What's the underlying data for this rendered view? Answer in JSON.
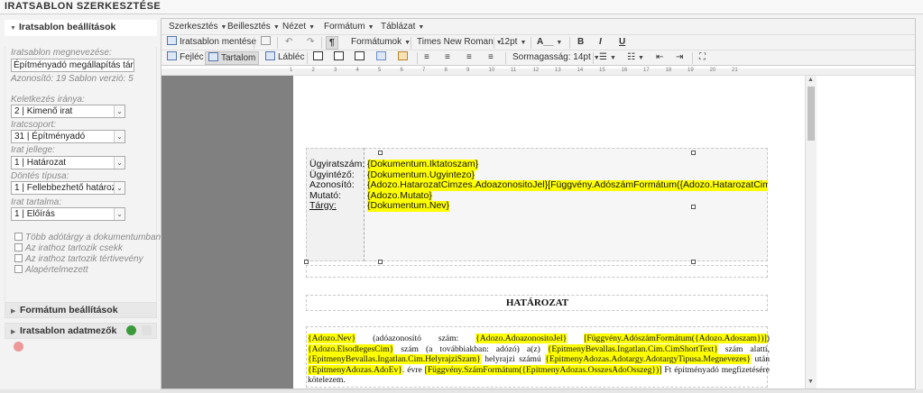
{
  "window": {
    "title": "IRATSABLON SZERKESZTÉSE"
  },
  "sidebar": {
    "settings_panel": {
      "title": "Iratsablon beállítások",
      "name_label": "Iratsablon megnevezése:",
      "name_value": "Építményadó megállapítás tárgy é",
      "meta_text": "Azonosító: 19  Sablon verzió: 5",
      "direction_label": "Keletkezés iránya:",
      "direction_value": "2 | Kimenő irat",
      "group_label": "Iratcsoport:",
      "group_value": "31 | Építményadó",
      "nature_label": "Irat jellege:",
      "nature_value": "1 | Határozat",
      "decision_label": "Döntés típusa:",
      "decision_value": "1 | Fellebbezhető határozat/v",
      "content_label": "Irat tartalma:",
      "content_value": "1 | Előírás",
      "checkboxes": [
        "Több adótárgy a dokumentumban",
        "Az irathoz tartozik csekk",
        "Az irathoz tartozik tértivevény",
        "Alapértelmezett"
      ]
    },
    "format_panel": {
      "title": "Formátum beállítások"
    },
    "fields_panel": {
      "title": "Iratsablon adatmezők"
    }
  },
  "editor": {
    "menus": [
      "Szerkesztés",
      "Beillesztés",
      "Nézet",
      "Formátum",
      "Táblázat"
    ],
    "toolbar1": {
      "save_label": "Iratsablon mentése",
      "formats_label": "Formátumok",
      "font_family": "Times New Roman",
      "font_size": "12pt",
      "font_color": "A__",
      "bold": "B",
      "italic": "I",
      "underline": "U",
      "pilcrow": "¶"
    },
    "toolbar2": {
      "header_label": "Fejléc",
      "content_label": "Tartalom",
      "footer_label": "Lábléc",
      "line_height_label": "Sormagasság: 14pt"
    },
    "ruler_ticks": [
      "1",
      "2",
      "3",
      "4",
      "5",
      "6",
      "7",
      "8",
      "9",
      "10",
      "11",
      "12",
      "13",
      "14",
      "15",
      "16",
      "17",
      "18",
      "19",
      "20",
      "21"
    ],
    "document": {
      "header_rows": [
        {
          "label": "Ügyiratszám:",
          "value": "{Dokumentum.Iktatoszam}"
        },
        {
          "label": "Ügyintéző:",
          "value": "{Dokumentum.Ugyintezo}"
        },
        {
          "label": "Azonosító:",
          "value": "{Adozo.HatarozatCimzes.AdoazonositoJel}[Függvény.AdószámFormátum({Adozo.HatarozatCimzes"
        },
        {
          "label": "Mutató:",
          "value": "{Adozo.Mutato}"
        },
        {
          "label": "Tárgy:",
          "value": "{Dokumentum.Nev}"
        }
      ],
      "title": "HATÁROZAT",
      "body": [
        {
          "t": "{Adozo.Nev}",
          "h": true
        },
        {
          "t": " (adóazonosító szám: ",
          "h": false
        },
        {
          "t": "{Adozo.AdoazonositoJel}",
          "h": true
        },
        {
          "t": " ",
          "h": false
        },
        {
          "t": "[Függvény.AdószámFormátum({Adozo.Adoszam})]",
          "h": true
        },
        {
          "t": ") ",
          "h": false
        },
        {
          "t": "{Adozo.ElsodlegesCim}",
          "h": true
        },
        {
          "t": " szám (a továbbiakban: adózó) a(z) ",
          "h": false
        },
        {
          "t": "{EpitmenyBevallas.Ingatlan.Cim.CimShortText}",
          "h": true
        },
        {
          "t": " szám alatti, ",
          "h": false
        },
        {
          "t": "{EpitmenyBevallas.Ingatlan.Cim.HelyrajziSzam}",
          "h": true
        },
        {
          "t": " helyrajzi számú ",
          "h": false
        },
        {
          "t": "{EpitmenyAdozas.Adotargy.AdotargyTipusa.Megnevezes}",
          "h": true
        },
        {
          "t": " után ",
          "h": false
        },
        {
          "t": "{EpitmenyAdozas.AdoEv}",
          "h": true
        },
        {
          "t": ". évre ",
          "h": false
        },
        {
          "t": "[Függvény.SzámFormátum({EpitmenyAdozas.OsszesAdoOsszeg})]",
          "h": true
        },
        {
          "t": " Ft építményadó megfizetésére kötelezem.",
          "h": false
        }
      ]
    }
  }
}
